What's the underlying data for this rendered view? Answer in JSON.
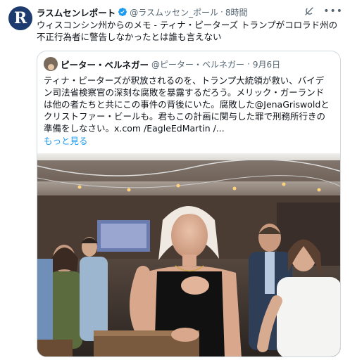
{
  "tweet": {
    "author_name": "ラスムセンレポート",
    "handle": "@ラスムッセン_ポール",
    "separator": "·",
    "time": "8時間",
    "avatar_letter": "R",
    "text": "ウィスコンシン州からのメモ - ティナ・ピーターズ トランプがコロラド州の\n不正行為者に警告しなかったとは誰も言えない"
  },
  "quote": {
    "author_name": "ピーター・ベルネガー",
    "handle": "@ピーター・ベルネガー",
    "separator": "·",
    "date": "9月6日",
    "text": "ティナ・ピーターズが釈放されるのを、トランプ大統領が救い、バイデ\nン司法省検察官の深刻な腐敗を暴露するだろう。メリック・ガーランド\nは他の者たちと共にこの事件の背後にいた。腐敗した@JenaGriswoldと\nクリストファー・ビールも。君もこの計画に関与した罪で刑務所行きの\n準備をしなさい。x.com /EagleEdMartin /...",
    "show_more": "もっと見る"
  },
  "colors": {
    "verified": "#1d9bf0",
    "link": "#1d9bf0",
    "secondary_text": "#536471",
    "avatar_bg": "#1d3b6e"
  },
  "icons": [
    "verified-badge-icon",
    "grok-icon",
    "more-options-icon"
  ]
}
